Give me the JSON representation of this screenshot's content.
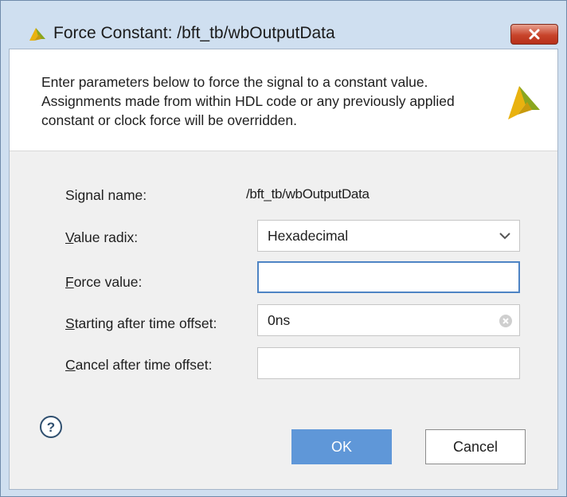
{
  "window": {
    "title": "Force Constant:  /bft_tb/wbOutputData"
  },
  "banner": {
    "text": "Enter parameters below to force the signal to a constant value. Assignments made from within HDL code or any previously applied constant or clock force will be overridden."
  },
  "form": {
    "signal_name": {
      "label": "Signal name:",
      "value": "/bft_tb/wbOutputData"
    },
    "value_radix": {
      "label_first": "V",
      "label_rest": "alue radix:",
      "value": "Hexadecimal"
    },
    "force_value": {
      "label_first": "F",
      "label_rest": "orce value:",
      "value": ""
    },
    "start_offset": {
      "label_first": "S",
      "label_rest": "tarting after time offset:",
      "value": "0ns"
    },
    "cancel_offset": {
      "label_first": "C",
      "label_rest": "ancel after time offset:",
      "value": ""
    }
  },
  "buttons": {
    "help": "?",
    "ok": "OK",
    "cancel": "Cancel"
  },
  "colors": {
    "ok_button": "#5f97d8",
    "focus_border": "#4e84c4",
    "close_button": "#c8442b",
    "logo_yellow": "#e9b20f",
    "logo_green": "#8aa61f"
  }
}
